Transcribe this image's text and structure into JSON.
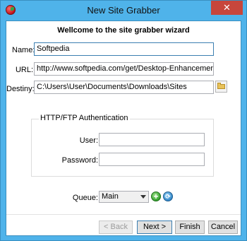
{
  "window": {
    "title": "New Site Grabber",
    "close_label": "✕"
  },
  "wizard": {
    "heading": "Wellcome to the site grabber wizard"
  },
  "fields": {
    "name_label": "Name:",
    "name_value": "Softpedia",
    "url_label": "URL:",
    "url_value": "http://www.softpedia.com/get/Desktop-Enhancements/Themes",
    "destiny_label": "Destiny:",
    "destiny_value": "C:\\Users\\User\\Documents\\Downloads\\Sites"
  },
  "auth": {
    "group_title": "HTTP/FTP Authentication",
    "user_label": "User:",
    "user_value": "",
    "password_label": "Password:",
    "password_value": ""
  },
  "queue": {
    "label": "Queue:",
    "selected": "Main"
  },
  "buttons": {
    "back": "< Back",
    "next": "Next >",
    "finish": "Finish",
    "cancel": "Cancel"
  },
  "colors": {
    "accent": "#4fb3ea",
    "close": "#c7463c"
  }
}
